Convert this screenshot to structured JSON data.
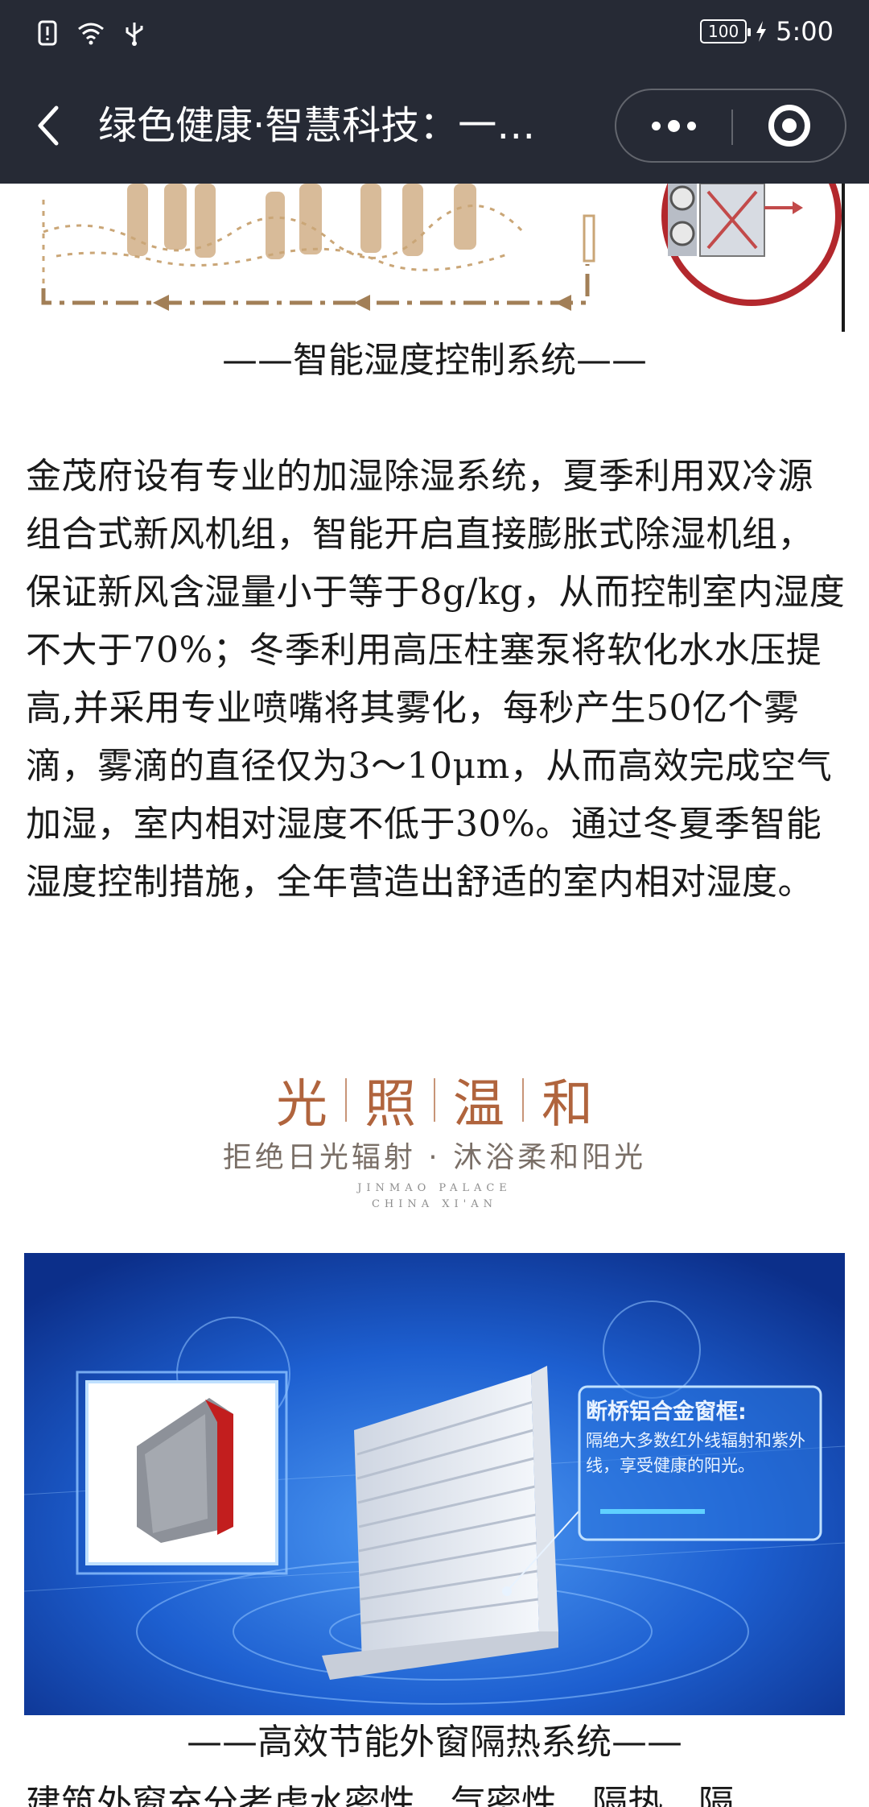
{
  "status_bar": {
    "time": "5:00",
    "battery": "100",
    "icons": [
      "alert-icon",
      "wifi-icon",
      "usb-icon",
      "charging-icon"
    ]
  },
  "nav": {
    "title": "绿色健康·智慧科技：一…",
    "back_icon": "back-arrow-icon",
    "more_icon": "more-dots-icon",
    "close_icon": "target-icon"
  },
  "article": {
    "caption_humidity": "——智能湿度控制系统——",
    "body_paragraph": "金茂府设有专业的加湿除湿系统，夏季利用双冷源组合式新风机组，智能开启直接膨胀式除湿机组，保证新风含湿量小于等于8g/kg，从而控制室内湿度不大于70%；冬季利用高压柱塞泵将软化水水压提高,并采用专业喷嘴将其雾化，每秒产生50亿个雾滴，雾滴的直径仅为3～10μm，从而高效完成空气加湿，室内相对湿度不低于30%。通过冬夏季智能湿度控制措施，全年营造出舒适的室内相对湿度。",
    "banner": {
      "title_chars": [
        "光",
        "照",
        "温",
        "和"
      ],
      "subtitle": "拒绝日光辐射 · 沐浴柔和阳光",
      "en_line1": "JINMAO PALACE",
      "en_line2": "CHINA XI'AN"
    },
    "photo_label": {
      "title": "断桥铝合金窗框:",
      "text": "隔绝大多数红外线辐射和紫外线，享受健康的阳光。"
    },
    "caption_window": "——高效节能外窗隔热系统——",
    "next_line": "建筑外窗充分考虑水密性、气密性、隔热、隔"
  }
}
